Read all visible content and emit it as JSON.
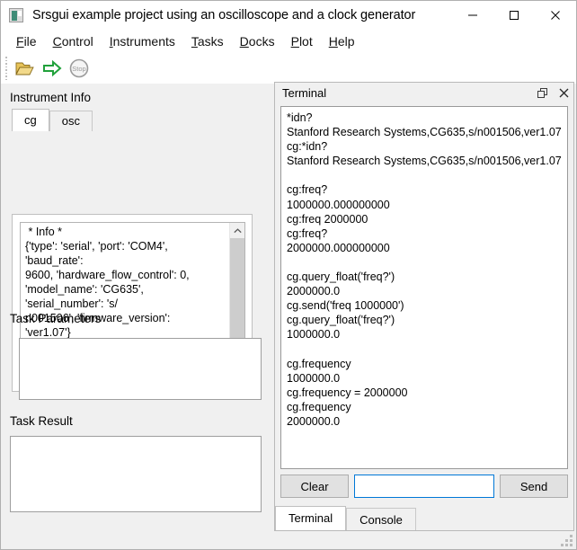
{
  "window": {
    "title": "Srsgui example project using an oscilloscope and a clock generator",
    "icon": "app-icon",
    "minimize_label": "—",
    "maximize_label": "□",
    "close_label": "✕"
  },
  "menubar": {
    "items": [
      {
        "label": "File",
        "mnemonic": "F"
      },
      {
        "label": "Control",
        "mnemonic": "C"
      },
      {
        "label": "Instruments",
        "mnemonic": "I"
      },
      {
        "label": "Tasks",
        "mnemonic": "T"
      },
      {
        "label": "Docks",
        "mnemonic": "D"
      },
      {
        "label": "Plot",
        "mnemonic": "P"
      },
      {
        "label": "Help",
        "mnemonic": "H"
      }
    ]
  },
  "toolbar": {
    "buttons": [
      {
        "name": "open-folder-icon",
        "tooltip": "Open"
      },
      {
        "name": "run-arrow-icon",
        "tooltip": "Run"
      },
      {
        "name": "stop-icon",
        "tooltip": "Stop",
        "label": "Stop"
      }
    ]
  },
  "left_panel": {
    "instrument_info_label": "Instrument Info",
    "tabs": [
      {
        "label": "cg",
        "active": true
      },
      {
        "label": "osc",
        "active": false
      }
    ],
    "info_text": " * Info *\n{'type': 'serial', 'port': 'COM4', 'baud_rate':\n9600, 'hardware_flow_control': 0,\n'model_name': 'CG635', 'serial_number': 's/\nn001506', 'firmware_version': 'ver1.07'}\n\n * Status *\n Not implemented: Override\nInstrument.get_status() to returns a status\nstring",
    "task_parameters_label": "Task Parameters",
    "task_parameters_value": "",
    "task_result_label": "Task Result",
    "task_result_value": ""
  },
  "terminal_dock": {
    "title": "Terminal",
    "float_button": "float-icon",
    "close_button": "close-icon",
    "output": "*idn?\nStanford Research Systems,CG635,s/n001506,ver1.07\ncg:*idn?\nStanford Research Systems,CG635,s/n001506,ver1.07\n\ncg:freq?\n1000000.000000000\ncg:freq 2000000\ncg:freq?\n2000000.000000000\n\ncg.query_float('freq?')\n2000000.0\ncg.send('freq 1000000')\ncg.query_float('freq?')\n1000000.0\n\ncg.frequency\n1000000.0\ncg.frequency = 2000000\ncg.frequency\n2000000.0",
    "clear_label": "Clear",
    "send_label": "Send",
    "command_value": "",
    "command_placeholder": "",
    "tabs": [
      {
        "label": "Terminal",
        "active": true
      },
      {
        "label": "Console",
        "active": false
      }
    ]
  },
  "colors": {
    "window_bg": "#f0f0f0",
    "titlebar_bg": "#ffffff",
    "field_bg": "#ffffff",
    "focus_border": "#0078d7",
    "button_bg": "#e1e1e1",
    "folder_icon": "#d8a425",
    "run_arrow": "#21a13b",
    "stop_icon": "#9a9a9a"
  }
}
